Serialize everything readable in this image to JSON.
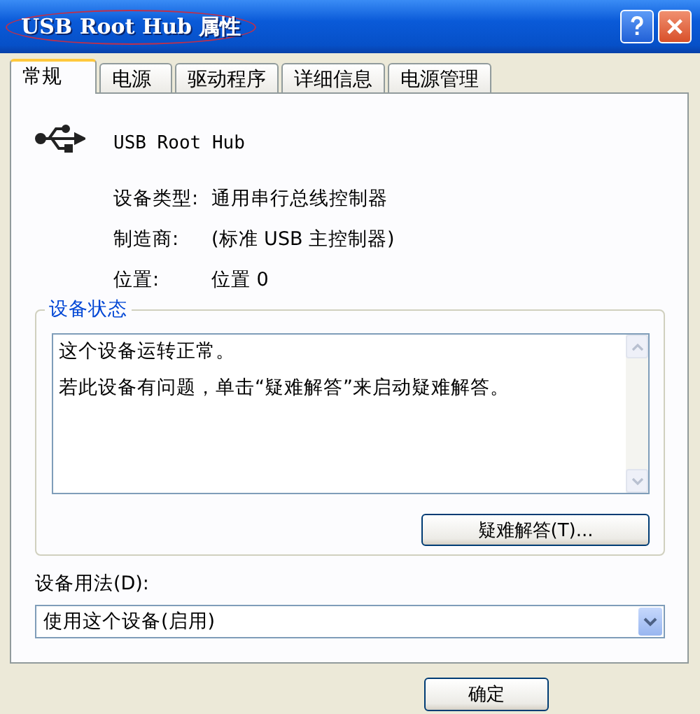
{
  "window": {
    "title": "USB Root Hub 属性"
  },
  "tabs": [
    {
      "label": "常规",
      "selected": true
    },
    {
      "label": "电源",
      "selected": false
    },
    {
      "label": "驱动程序",
      "selected": false
    },
    {
      "label": "详细信息",
      "selected": false
    },
    {
      "label": "电源管理",
      "selected": false
    }
  ],
  "device": {
    "name": "USB Root Hub"
  },
  "properties": [
    {
      "label": "设备类型:",
      "value": "通用串行总线控制器"
    },
    {
      "label": "制造商:",
      "value": "(标准 USB 主控制器)"
    },
    {
      "label": "位置:",
      "value": "位置 0"
    }
  ],
  "device_status": {
    "title": "设备状态",
    "lines": [
      "这个设备运转正常。",
      "若此设备有问题，单击“疑难解答”来启动疑难解答。"
    ],
    "button": "疑难解答(T)..."
  },
  "device_usage": {
    "label": "设备用法(D):",
    "value": "使用这个设备(启用)"
  },
  "buttons": [
    "确定"
  ]
}
